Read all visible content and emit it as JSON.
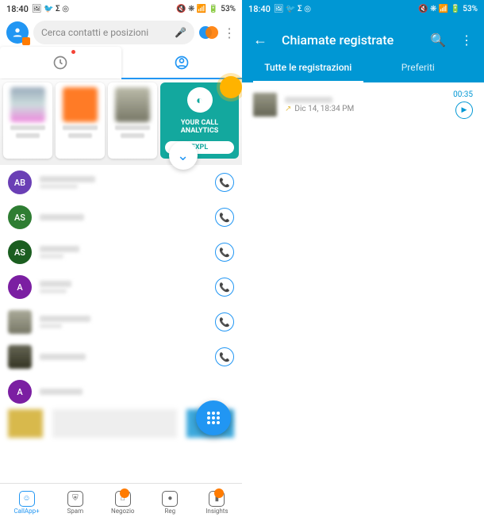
{
  "status": {
    "time": "18:40",
    "battery": "53%",
    "left_icons": "🖼 🐦 Σ ◎",
    "right_icons": "🔇 ❋ 📶 🔋"
  },
  "left": {
    "search_placeholder": "Cerca contatti e posizioni",
    "promo": {
      "line": "YOUR CALL ANALYTICS",
      "btn": "EXPL"
    },
    "contacts": [
      {
        "initials": "AB",
        "color": "ci-purple"
      },
      {
        "initials": "AS",
        "color": "ci-green"
      },
      {
        "initials": "AS",
        "color": "ci-darkgreen"
      },
      {
        "initials": "A",
        "color": "ci-violet"
      },
      {
        "initials": "",
        "color": "ci-img1"
      },
      {
        "initials": "",
        "color": "ci-img2"
      },
      {
        "initials": "A",
        "color": "ci-violet"
      }
    ],
    "nav": {
      "callapp": "CallApp+",
      "spam": "Spam",
      "negozio": "Negozio",
      "reg": "Reg",
      "insights": "Insights"
    }
  },
  "right": {
    "title": "Chiamate registrate",
    "tab_all": "Tutte le registrazioni",
    "tab_fav": "Preferiti",
    "recording": {
      "date": "Dic 14, 18:34 PM",
      "duration": "00:35"
    }
  }
}
